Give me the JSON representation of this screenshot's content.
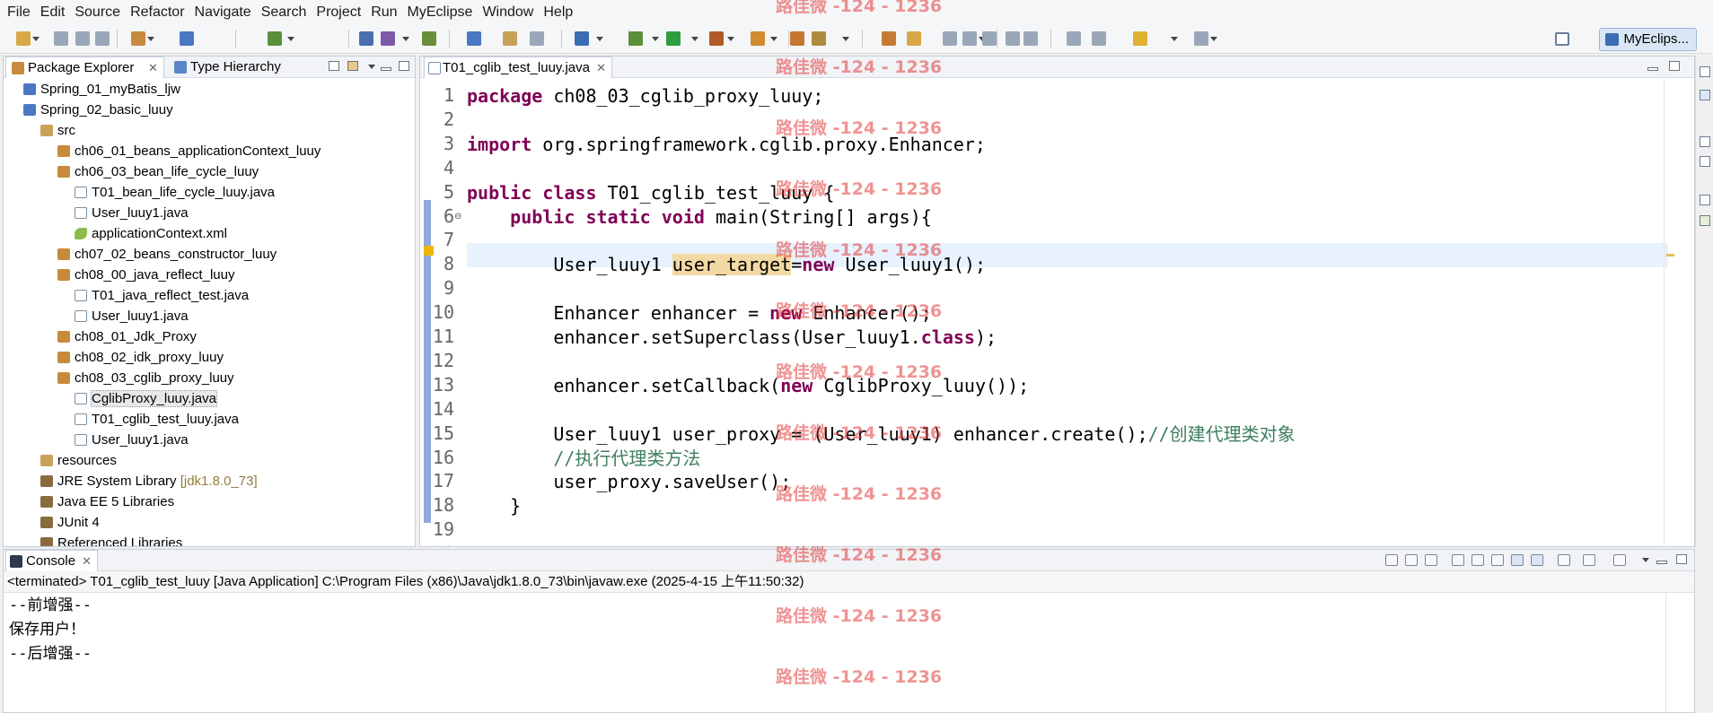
{
  "menu": [
    "File",
    "Edit",
    "Source",
    "Refactor",
    "Navigate",
    "Search",
    "Project",
    "Run",
    "MyEclipse",
    "Window",
    "Help"
  ],
  "toolbar": {
    "perspective_label": "MyEclips...",
    "icons": [
      "new-icon",
      "save-icon",
      "save-all-icon",
      "print-icon",
      "new-project-icon",
      "open-type-icon",
      "debug-icon",
      "run-icon",
      "external-tools-icon",
      "search-icon",
      "back-icon",
      "forward-icon"
    ]
  },
  "package_explorer": {
    "tab_label": "Package Explorer",
    "second_tab_label": "Type Hierarchy",
    "tree": [
      {
        "label": "Spring_01_myBatis_ljw",
        "type": "project",
        "depth": 0
      },
      {
        "label": "Spring_02_basic_luuy",
        "type": "project",
        "depth": 0
      },
      {
        "label": "src",
        "type": "srcfolder",
        "depth": 1
      },
      {
        "label": "ch06_01_beans_applicationContext_luuy",
        "type": "package",
        "depth": 2
      },
      {
        "label": "ch06_03_bean_life_cycle_luuy",
        "type": "package",
        "depth": 2
      },
      {
        "label": "T01_bean_life_cycle_luuy.java",
        "type": "java",
        "depth": 3
      },
      {
        "label": "User_luuy1.java",
        "type": "java",
        "depth": 3
      },
      {
        "label": "applicationContext.xml",
        "type": "xml",
        "depth": 3
      },
      {
        "label": "ch07_02_beans_constructor_luuy",
        "type": "package",
        "depth": 2
      },
      {
        "label": "ch08_00_java_reflect_luuy",
        "type": "package",
        "depth": 2
      },
      {
        "label": "T01_java_reflect_test.java",
        "type": "java",
        "depth": 3
      },
      {
        "label": "User_luuy1.java",
        "type": "java",
        "depth": 3
      },
      {
        "label": "ch08_01_Jdk_Proxy",
        "type": "package",
        "depth": 2
      },
      {
        "label": "ch08_02_idk_proxy_luuy",
        "type": "package",
        "depth": 2
      },
      {
        "label": "ch08_03_cglib_proxy_luuy",
        "type": "package",
        "depth": 2
      },
      {
        "label": "CglibProxy_luuy.java",
        "type": "java",
        "depth": 3,
        "selected": true
      },
      {
        "label": "T01_cglib_test_luuy.java",
        "type": "java",
        "depth": 3
      },
      {
        "label": "User_luuy1.java",
        "type": "java",
        "depth": 3
      },
      {
        "label": "resources",
        "type": "srcfolder",
        "depth": 1
      },
      {
        "label": "JRE System Library",
        "decoration": "[jdk1.8.0_73]",
        "type": "lib",
        "depth": 1
      },
      {
        "label": "Java EE 5 Libraries",
        "type": "lib",
        "depth": 1
      },
      {
        "label": "JUnit 4",
        "type": "lib",
        "depth": 1
      },
      {
        "label": "Referenced Libraries",
        "type": "lib",
        "depth": 1
      }
    ]
  },
  "editor": {
    "tab_label": "T01_cglib_test_luuy.java",
    "lines": [
      [
        {
          "t": "package",
          "k": "kw"
        },
        {
          "t": " ch08_03_cglib_proxy_luuy;"
        }
      ],
      [],
      [
        {
          "t": "import",
          "k": "kw"
        },
        {
          "t": " org.springframework.cglib.proxy.Enhancer;"
        }
      ],
      [],
      [
        {
          "t": "public",
          "k": "kw"
        },
        {
          "t": " "
        },
        {
          "t": "class",
          "k": "kw"
        },
        {
          "t": " T01_cglib_test_luuy {"
        }
      ],
      [
        {
          "t": "    "
        },
        {
          "t": "public",
          "k": "kw"
        },
        {
          "t": " "
        },
        {
          "t": "static",
          "k": "kw"
        },
        {
          "t": " "
        },
        {
          "t": "void",
          "k": "kw"
        },
        {
          "t": " main(String[] args){"
        }
      ],
      [],
      [
        {
          "t": "        User_luuy1 "
        },
        {
          "t": "user_target",
          "k": "hl"
        },
        {
          "t": "="
        },
        {
          "t": "new",
          "k": "kw"
        },
        {
          "t": " User_luuy1();"
        }
      ],
      [],
      [
        {
          "t": "        Enhancer enhancer = "
        },
        {
          "t": "new",
          "k": "kw"
        },
        {
          "t": " Enhancer();"
        }
      ],
      [
        {
          "t": "        enhancer.setSuperclass(User_luuy1."
        },
        {
          "t": "class",
          "k": "kw"
        },
        {
          "t": ");"
        }
      ],
      [],
      [
        {
          "t": "        enhancer.setCallback("
        },
        {
          "t": "new",
          "k": "kw"
        },
        {
          "t": " CglibProxy_luuy());"
        }
      ],
      [],
      [
        {
          "t": "        User_luuy1 user_proxy = (User_luuy1) enhancer.create();"
        },
        {
          "t": "//创建代理类对象",
          "k": "cm"
        }
      ],
      [
        {
          "t": "        "
        },
        {
          "t": "//执行代理类方法",
          "k": "cm"
        }
      ],
      [
        {
          "t": "        user_proxy.saveUser();"
        }
      ],
      [
        {
          "t": "    }"
        }
      ],
      [],
      [
        {
          "t": "}"
        }
      ]
    ]
  },
  "console": {
    "tab_label": "Console",
    "description": "<terminated> T01_cglib_test_luuy [Java Application] C:\\Program Files (x86)\\Java\\jdk1.8.0_73\\bin\\javaw.exe (2025-4-15 上午11:50:32)",
    "output": [
      "--前增强--",
      "保存用户！",
      "--后增强--"
    ]
  },
  "watermark": "路佳微 -124 - 1236",
  "colors": {
    "keyword": "#7f0055",
    "comment": "#3f7f5f",
    "occurrence": "#f3d9a3",
    "current_line": "#e8f2fe"
  }
}
